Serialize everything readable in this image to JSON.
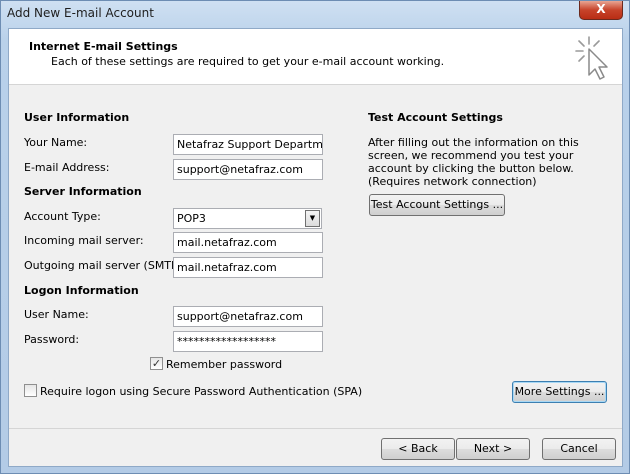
{
  "window": {
    "title": "Add New E-mail Account",
    "close_label": "X"
  },
  "header": {
    "title": "Internet E-mail Settings",
    "subtitle": "Each of these settings are required to get your e-mail account working."
  },
  "user_info": {
    "heading": "User Information",
    "name_label": "Your Name:",
    "name_value": "Netafraz Support Department",
    "email_label": "E-mail Address:",
    "email_value": "support@netafraz.com"
  },
  "server_info": {
    "heading": "Server Information",
    "account_type_label": "Account Type:",
    "account_type_value": "POP3",
    "incoming_label": "Incoming mail server:",
    "incoming_value": "mail.netafraz.com",
    "outgoing_label": "Outgoing mail server (SMTP):",
    "outgoing_value": "mail.netafraz.com"
  },
  "logon_info": {
    "heading": "Logon Information",
    "username_label": "User Name:",
    "username_value": "support@netafraz.com",
    "password_label": "Password:",
    "password_value": "******************",
    "remember_label": "Remember password",
    "remember_checked": true,
    "spa_label": "Require logon using Secure Password Authentication (SPA)",
    "spa_checked": false
  },
  "test_settings": {
    "heading": "Test Account Settings",
    "description": "After filling out the information on this screen, we recommend you test your account by clicking the button below. (Requires network connection)",
    "test_button": "Test Account Settings ..."
  },
  "buttons": {
    "more_settings": "More Settings ...",
    "back": "< Back",
    "next": "Next >",
    "cancel": "Cancel"
  },
  "icons": {
    "header_icon": "cursor-click-icon",
    "checkmark": "✓",
    "dropdown": "▼"
  },
  "colors": {
    "title_bar": "#b9d1ea",
    "close_button": "#c7432a",
    "focus_border": "#3c7fb1"
  }
}
